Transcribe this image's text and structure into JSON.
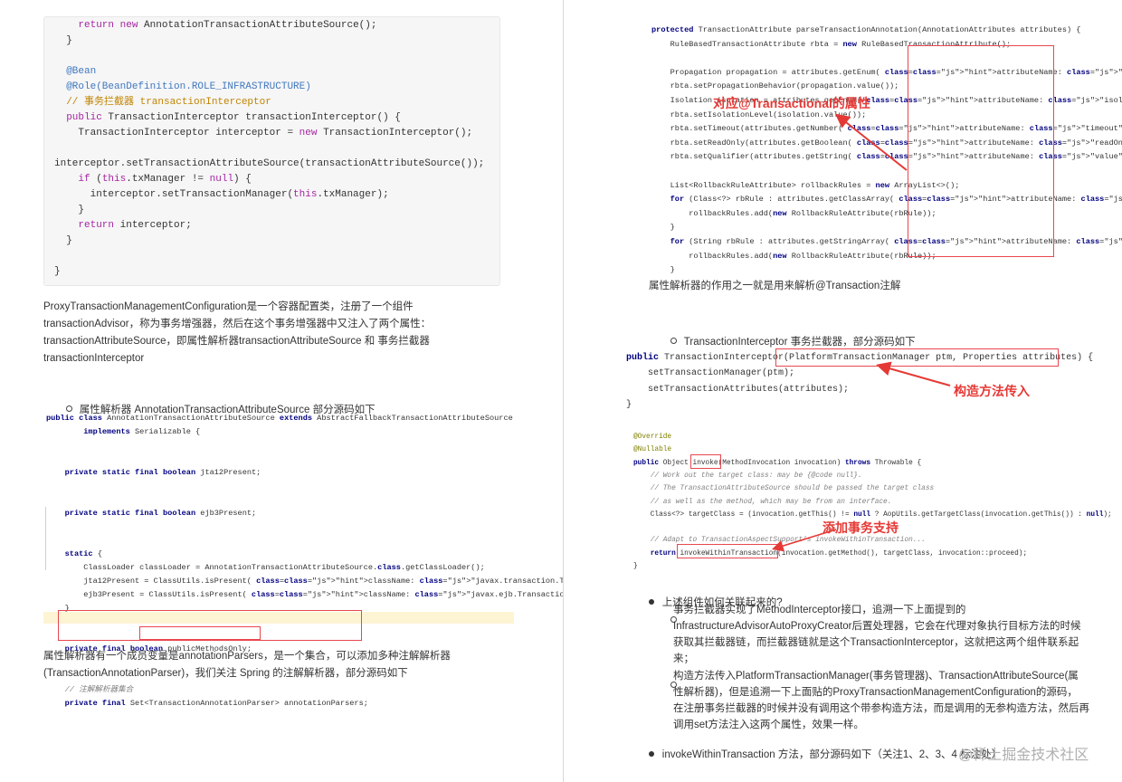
{
  "left": {
    "top_code": [
      "    return new AnnotationTransactionAttributeSource();",
      "  }",
      "",
      "  @Bean",
      "  @Role(BeanDefinition.ROLE_INFRASTRUCTURE)",
      "  // 事务拦截器 transactionInterceptor",
      "  public TransactionInterceptor transactionInterceptor() {",
      "    TransactionInterceptor interceptor = new TransactionInterceptor();",
      "",
      "interceptor.setTransactionAttributeSource(transactionAttributeSource());",
      "    if (this.txManager != null) {",
      "      interceptor.setTransactionManager(this.txManager);",
      "    }",
      "    return interceptor;",
      "  }",
      "",
      "}"
    ],
    "paragraph1": [
      "ProxyTransactionManagementConfiguration是一个容器配置类，注册了一个组件",
      "transactionAdvisor，称为事务增强器，然后在这个事务增强器中又注入了两个属性：",
      "transactionAttributeSource，即属性解析器transactionAttributeSource 和 事务拦截器",
      "transactionInterceptor"
    ],
    "bullet1": "属性解析器 AnnotationTransactionAttributeSource 部分源码如下",
    "java_code": [
      "public class AnnotationTransactionAttributeSource extends AbstractFallbackTransactionAttributeSource",
      "        implements Serializable {",
      "",
      "",
      "    private static final boolean jta12Present;",
      "",
      "",
      "    private static final boolean ejb3Present;",
      "",
      "",
      "    static {",
      "        ClassLoader classLoader = AnnotationTransactionAttributeSource.class.getClassLoader();",
      "        jta12Present = ClassUtils.isPresent( className: \"javax.transaction.Transactional\", classLoader);",
      "        ejb3Present = ClassUtils.isPresent( className: \"javax.ejb.TransactionAttribute\", classLoader);",
      "    }",
      "",
      "",
      "    private final boolean publicMethodsOnly;",
      "",
      "",
      "    // 注解解析器集合",
      "    private final Set<TransactionAnnotationParser> annotationParsers;"
    ],
    "paragraph2": [
      "属性解析器有一个成员变量是annotationParsers，是一个集合，可以添加多种注解解析器",
      "(TransactionAnnotationParser)，我们关注 Spring 的注解解析器，部分源码如下"
    ]
  },
  "right": {
    "parse_code": [
      "protected TransactionAttribute parseTransactionAnnotation(AnnotationAttributes attributes) {",
      "    RuleBasedTransactionAttribute rbta = new RuleBasedTransactionAttribute();",
      "",
      "    Propagation propagation = attributes.getEnum( attributeName: \"propagation\");",
      "    rbta.setPropagationBehavior(propagation.value());",
      "    Isolation isolation = attributes.getEnum( attributeName: \"isolation\");",
      "    rbta.setIsolationLevel(isolation.value());",
      "    rbta.setTimeout(attributes.getNumber( attributeName: \"timeout\").intValue());",
      "    rbta.setReadOnly(attributes.getBoolean( attributeName: \"readOnly\"));",
      "    rbta.setQualifier(attributes.getString( attributeName: \"value\"));",
      "",
      "    List<RollbackRuleAttribute> rollbackRules = new ArrayList<>();",
      "    for (Class<?> rbRule : attributes.getClassArray( attributeName: \"rollbackFor\")) {",
      "        rollbackRules.add(new RollbackRuleAttribute(rbRule));",
      "    }",
      "    for (String rbRule : attributes.getStringArray( attributeName: \"rollbackForClassName\")) {",
      "        rollbackRules.add(new RollbackRuleAttribute(rbRule));",
      "    }"
    ],
    "annotation_attrs": "对应@Transactional的属性",
    "caption1": "属性解析器的作用之一就是用来解析@Transaction注解",
    "bullet2": "TransactionInterceptor 事务拦截器，部分源码如下",
    "ctor_code": [
      "public TransactionInterceptor(PlatformTransactionManager ptm, Properties attributes) {",
      "    setTransactionManager(ptm);",
      "    setTransactionAttributes(attributes);",
      "}"
    ],
    "annotation_ctor": "构造方法传入",
    "invoke_code": [
      "@Override",
      "@Nullable",
      "public Object invoke(MethodInvocation invocation) throws Throwable {",
      "    // Work out the target class: may be {@code null}.",
      "    // The TransactionAttributeSource should be passed the target class",
      "    // as well as the method, which may be from an interface.",
      "    Class<?> targetClass = (invocation.getThis() != null ? AopUtils.getTargetClass(invocation.getThis()) : null);",
      "",
      "    // Adapt to TransactionAspectSupport's invokeWithinTransaction...",
      "    return invokeWithinTransaction(invocation.getMethod(), targetClass, invocation::proceed);",
      "}"
    ],
    "annotation_tx": "添加事务支持",
    "bullet3": "上述组件如何关联起来的?",
    "sub1": [
      "事务拦截器实现了MethodInterceptor接口，追溯一下上面提到的",
      "InfrastructureAdvisorAutoProxyCreator后置处理器，它会在代理对象执行目标方法的时候",
      "获取其拦截器链，而拦截器链就是这个TransactionInterceptor，这就把这两个组件联系起",
      "来；"
    ],
    "sub2": [
      "构造方法传入PlatformTransactionManager(事务管理器)、TransactionAttributeSource(属",
      "性解析器)，但是追溯一下上面贴的ProxyTransactionManagementConfiguration的源码，",
      "在注册事务拦截器的时候并没有调用这个带参构造方法，而是调用的无参构造方法，然后再",
      "调用set方法注入这两个属性，效果一样。"
    ],
    "bullet4": "invokeWithinTransaction 方法，部分源码如下（关注1、2、3、4 标注处）",
    "watermark": "@稀土掘金技术社区"
  }
}
